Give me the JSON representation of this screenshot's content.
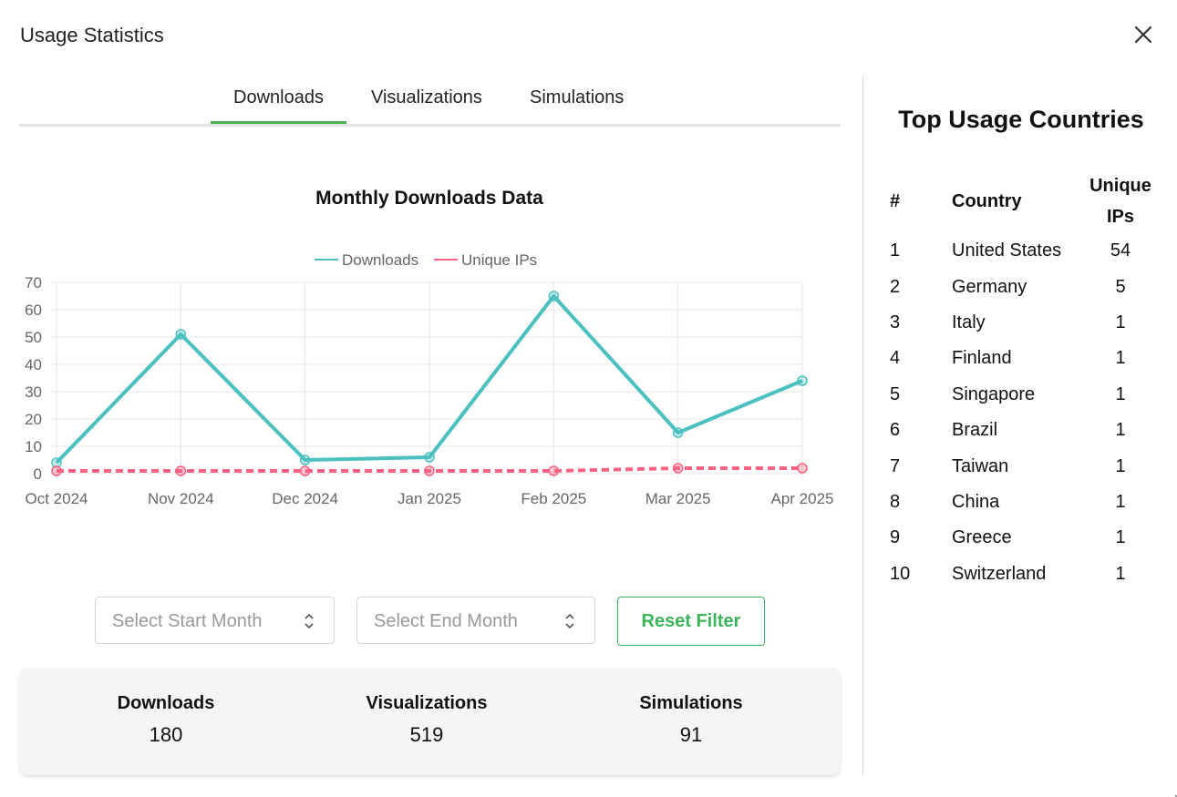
{
  "dialog": {
    "title": "Usage Statistics",
    "close_icon": "close-icon"
  },
  "tabs": [
    {
      "label": "Downloads",
      "active": true
    },
    {
      "label": "Visualizations",
      "active": false
    },
    {
      "label": "Simulations",
      "active": false
    }
  ],
  "chart_data": {
    "type": "line",
    "title": "Monthly Downloads Data",
    "x": [
      "Oct 2024",
      "Nov 2024",
      "Dec 2024",
      "Jan 2025",
      "Feb 2025",
      "Mar 2025",
      "Apr 2025"
    ],
    "series": [
      {
        "name": "Downloads",
        "values": [
          4,
          51,
          5,
          6,
          65,
          15,
          34
        ],
        "color": "#4bc0c0",
        "dashed": false
      },
      {
        "name": "Unique IPs",
        "values": [
          1,
          1,
          1,
          1,
          1,
          2,
          2
        ],
        "color": "#ff6384",
        "dashed": true
      }
    ],
    "ylim": [
      0,
      70
    ],
    "yticks": [
      0,
      10,
      20,
      30,
      40,
      50,
      60,
      70
    ],
    "grid": true,
    "legend": "top-center"
  },
  "filters": {
    "start_placeholder": "Select Start Month",
    "end_placeholder": "Select End Month",
    "reset_label": "Reset Filter",
    "accent": "#3cb45a"
  },
  "summary": [
    {
      "label": "Downloads",
      "value": "180"
    },
    {
      "label": "Visualizations",
      "value": "519"
    },
    {
      "label": "Simulations",
      "value": "91"
    }
  ],
  "countries": {
    "title": "Top Usage Countries",
    "headers": {
      "rank": "#",
      "country": "Country",
      "ips": "Unique IPs"
    },
    "rows": [
      {
        "rank": "1",
        "country": "United States",
        "ips": "54"
      },
      {
        "rank": "2",
        "country": "Germany",
        "ips": "5"
      },
      {
        "rank": "3",
        "country": "Italy",
        "ips": "1"
      },
      {
        "rank": "4",
        "country": "Finland",
        "ips": "1"
      },
      {
        "rank": "5",
        "country": "Singapore",
        "ips": "1"
      },
      {
        "rank": "6",
        "country": "Brazil",
        "ips": "1"
      },
      {
        "rank": "7",
        "country": "Taiwan",
        "ips": "1"
      },
      {
        "rank": "8",
        "country": "China",
        "ips": "1"
      },
      {
        "rank": "9",
        "country": "Greece",
        "ips": "1"
      },
      {
        "rank": "10",
        "country": "Switzerland",
        "ips": "1"
      }
    ]
  }
}
